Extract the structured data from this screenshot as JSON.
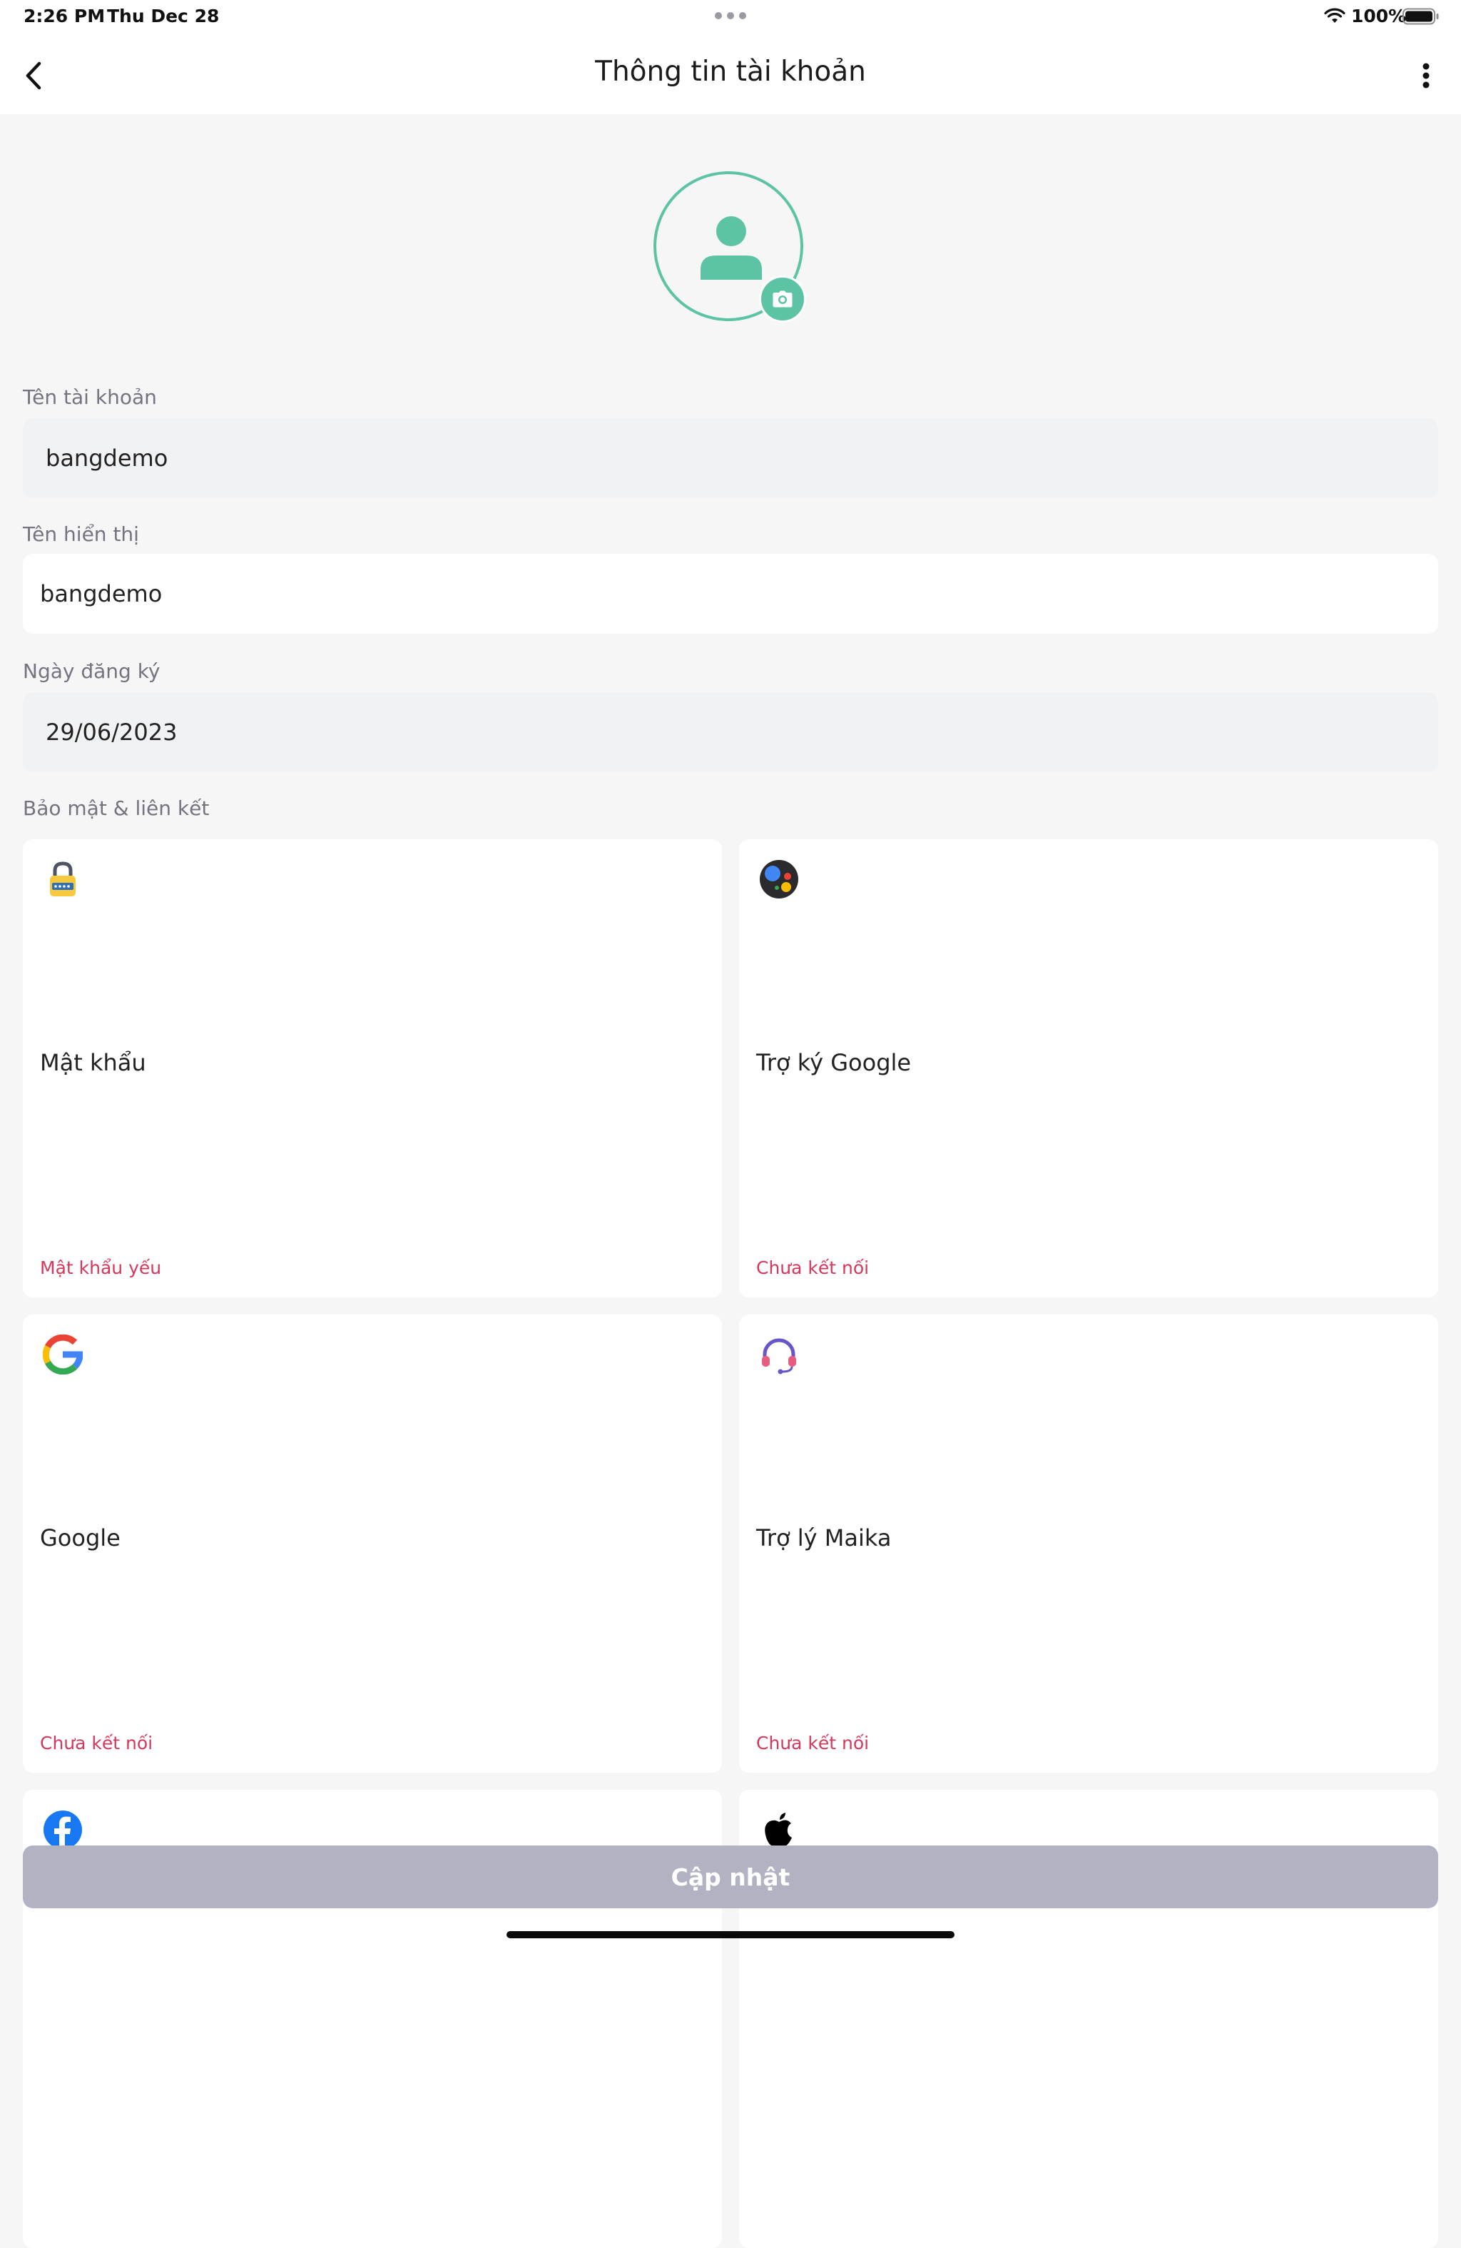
{
  "status_bar": {
    "time": "2:26 PM",
    "date": "Thu Dec 28",
    "battery": "100%"
  },
  "header": {
    "title": "Thông tin tài khoản",
    "back_icon": "chevron-left-icon",
    "more_icon": "more-vertical-icon"
  },
  "profile": {
    "avatar_icon": "user-icon",
    "camera_icon": "camera-icon"
  },
  "fields": {
    "account_name": {
      "label": "Tên tài khoản",
      "value": "bangdemo"
    },
    "display_name": {
      "label": "Tên hiển thị",
      "value": "bangdemo"
    },
    "register_date": {
      "label": "Ngày đăng ký",
      "value": "29/06/2023"
    }
  },
  "security": {
    "section_label": "Bảo mật & liên kết",
    "cards": [
      {
        "icon": "lock-icon",
        "title": "Mật khẩu",
        "status": "Mật khẩu yếu"
      },
      {
        "icon": "google-assistant-icon",
        "title": "Trợ ký Google",
        "status": "Chưa kết nối"
      },
      {
        "icon": "google-icon",
        "title": "Google",
        "status": "Chưa kết nối"
      },
      {
        "icon": "headset-icon",
        "title": "Trợ lý Maika",
        "status": "Chưa kết nối"
      },
      {
        "icon": "facebook-icon",
        "title": "",
        "status": ""
      },
      {
        "icon": "apple-icon",
        "title": "",
        "status": ""
      }
    ]
  },
  "update_button": {
    "label": "Cập nhật"
  },
  "colors": {
    "accent": "#5cc4a5",
    "status_red": "#d6385b",
    "button_disabled": "#b1b3c2",
    "background": "#f6f6f7"
  }
}
